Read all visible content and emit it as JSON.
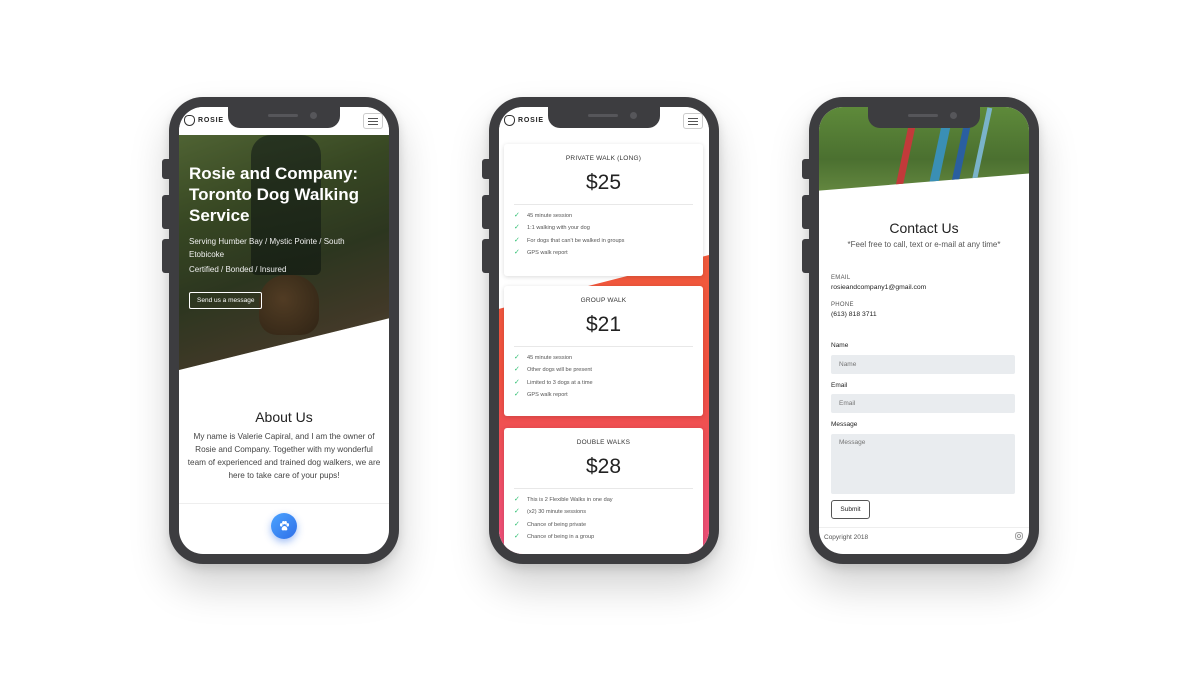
{
  "brand": {
    "name": "ROSIE"
  },
  "phone1": {
    "hero": {
      "title": "Rosie and Company: Toronto Dog Walking Service",
      "areas": "Serving Humber Bay / Mystic Pointe / South Etobicoke",
      "credentials": "Certified / Bonded / Insured",
      "cta": "Send us a message"
    },
    "about": {
      "title": "About Us",
      "text": "My name is Valerie Capiral, and I am the owner of Rosie and Company. Together with my wonderful team of experienced and trained dog walkers, we are here to take care of your pups!"
    },
    "paw_icon": "paw-icon"
  },
  "phone2": {
    "cards": [
      {
        "title": "PRIVATE WALK (LONG)",
        "price": "$25",
        "features": [
          "45 minute session",
          "1:1 walking with your dog",
          "For dogs that can't be walked in groups",
          "GPS walk report"
        ]
      },
      {
        "title": "GROUP WALK",
        "price": "$21",
        "features": [
          "45 minute session",
          "Other dogs will be present",
          "Limited to 3 dogs at a time",
          "GPS walk report"
        ]
      },
      {
        "title": "DOUBLE WALKS",
        "price": "$28",
        "features": [
          "This is 2 Flexible Walks in one day",
          "(x2) 30 minute sessions",
          "Chance of being private",
          "Chance of being in a group"
        ]
      }
    ],
    "colors": {
      "gradient_top": "#f15a3c",
      "gradient_bottom": "#ec4f7a",
      "check": "#2fbf71"
    }
  },
  "phone3": {
    "title": "Contact Us",
    "subtitle": "*Feel free to call, text or e-mail at any time*",
    "email_label": "EMAIL",
    "email_value": "rosieandcompany1@gmail.com",
    "phone_label": "PHONE",
    "phone_value": "(613) 818 3711",
    "form": {
      "name_label": "Name",
      "name_placeholder": "Name",
      "email_label": "Email",
      "email_placeholder": "Email",
      "message_label": "Message",
      "message_placeholder": "Message",
      "submit": "Submit"
    },
    "footer": {
      "copyright": "Copyright 2018",
      "icon": "instagram-icon"
    }
  }
}
